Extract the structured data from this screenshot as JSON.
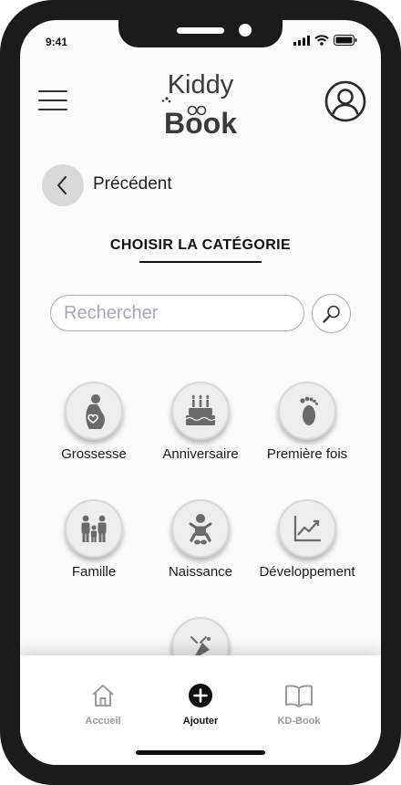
{
  "status_bar": {
    "time": "9:41",
    "icons": [
      "signal-icon",
      "wifi-icon",
      "battery-icon"
    ]
  },
  "header": {
    "menu_icon": "hamburger-menu-icon",
    "logo": {
      "line1": "Kiddy",
      "line2": "Book"
    },
    "profile_icon": "user-profile-icon"
  },
  "nav_back": {
    "label": "Précédent",
    "icon": "chevron-left-icon"
  },
  "page": {
    "title": "CHOISIR LA CATÉGORIE"
  },
  "search": {
    "placeholder": "Rechercher",
    "value": "",
    "icon": "search-icon"
  },
  "categories": [
    {
      "label": "Grossesse",
      "icon": "pregnancy-icon"
    },
    {
      "label": "Anniversaire",
      "icon": "birthday-cake-icon"
    },
    {
      "label": "Première fois",
      "icon": "footprints-icon"
    },
    {
      "label": "Famille",
      "icon": "family-icon"
    },
    {
      "label": "Naissance",
      "icon": "baby-icon"
    },
    {
      "label": "Développement",
      "icon": "growth-chart-icon"
    },
    {
      "label": "",
      "icon": "party-popper-icon"
    }
  ],
  "bottom_nav": [
    {
      "label": "Accueil",
      "icon": "home-icon",
      "active": false
    },
    {
      "label": "Ajouter",
      "icon": "add-circle-icon",
      "active": true
    },
    {
      "label": "KD-Book",
      "icon": "open-book-icon",
      "active": false
    }
  ],
  "colors": {
    "accent": "#111111",
    "inactive": "#9b9b9b",
    "category_bg": "#eeeded",
    "back_button": "#d8d8d8"
  }
}
